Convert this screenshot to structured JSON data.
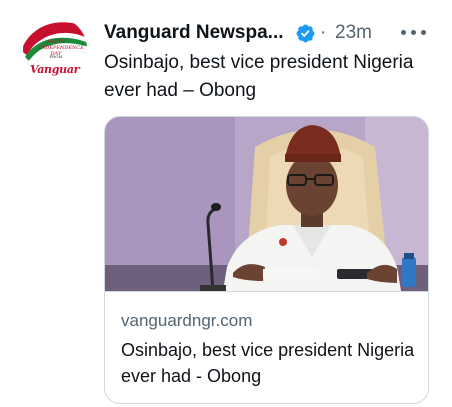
{
  "tweet": {
    "author": "Vanguard Newspa...",
    "verified": true,
    "separator": "·",
    "time": "23m",
    "text": "Osinbajo, best vice president Nigeria ever had – Obong",
    "more_icon": "more-horizontal-icon"
  },
  "avatar": {
    "line1": "HAPPY",
    "line2": "INDEPENDENCE DAY",
    "line3": "FROM",
    "logo": "Vanguard"
  },
  "card": {
    "domain": "vanguardngr.com",
    "title": "Osinbajo, best vice president Nigeria ever had - Obong"
  },
  "colors": {
    "verified": "#1d9bf0",
    "secondary_text": "#536471",
    "border": "#cfd9de",
    "brand_red": "#c8102e"
  }
}
